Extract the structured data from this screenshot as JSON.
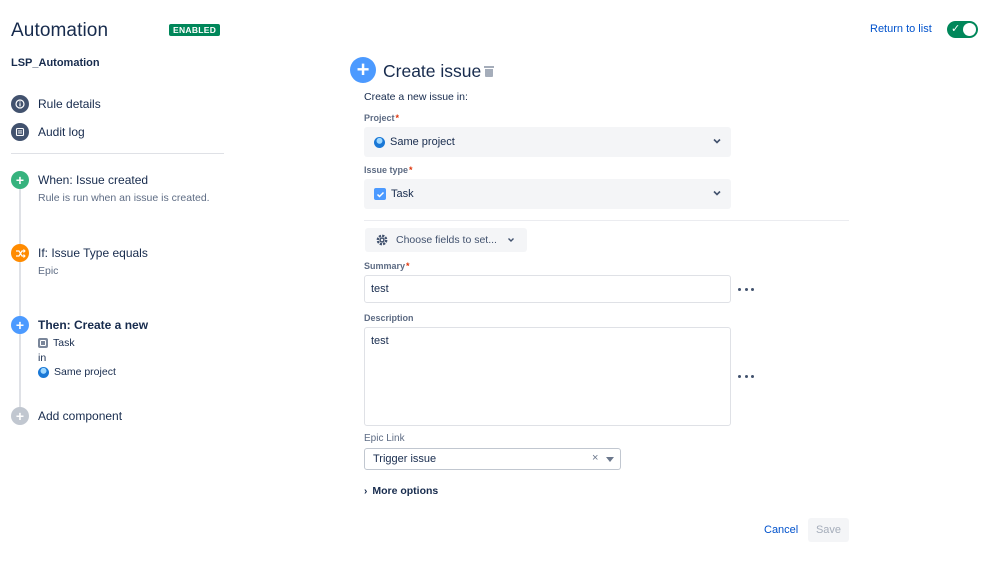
{
  "header": {
    "title": "Automation",
    "status_badge": "ENABLED",
    "return_link": "Return to list",
    "toggle_enabled": true
  },
  "sidebar": {
    "rule_name": "LSP_Automation",
    "nav": [
      {
        "label": "Rule details",
        "icon": "info-icon"
      },
      {
        "label": "Audit log",
        "icon": "log-icon"
      }
    ],
    "steps": {
      "trigger": {
        "title": "When: Issue created",
        "subtitle": "Rule is run when an issue is created.",
        "color": "#36b37e"
      },
      "condition": {
        "title": "If: Issue Type equals",
        "subtitle": "Epic",
        "color": "#ff8b00"
      },
      "action": {
        "title": "Then: Create a new",
        "issue_type": "Task",
        "connector": "in",
        "project": "Same project",
        "color": "#4c9aff"
      },
      "add": {
        "title": "Add component",
        "color": "#c1c7d0"
      }
    }
  },
  "main": {
    "title": "Create issue",
    "intro": "Create a new issue in:",
    "project": {
      "label": "Project",
      "required_mark": "*",
      "value": "Same project"
    },
    "issue_type": {
      "label": "Issue type",
      "required_mark": "*",
      "value": "Task"
    },
    "choose_fields": "Choose fields to set...",
    "summary": {
      "label": "Summary",
      "required_mark": "*",
      "value": "test"
    },
    "description": {
      "label": "Description",
      "value": "test"
    },
    "epic_link": {
      "label": "Epic Link",
      "value": "Trigger issue",
      "clear": "×"
    },
    "more_options": "More options",
    "more_options_arrow": "›",
    "cancel": "Cancel",
    "save": "Save"
  }
}
